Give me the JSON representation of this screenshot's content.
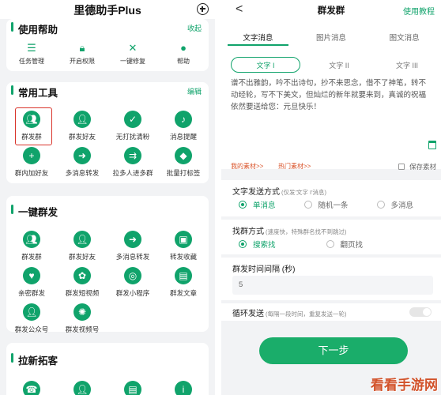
{
  "left": {
    "title": "里德助手Plus",
    "help_section": {
      "title": "使用帮助",
      "action": "收起",
      "items": [
        {
          "label": "任务管理",
          "icon": "task-list-icon"
        },
        {
          "label": "开启权限",
          "icon": "lock-icon"
        },
        {
          "label": "一键修复",
          "icon": "wrench-icon"
        },
        {
          "label": "帮助",
          "icon": "help-pin-icon"
        }
      ]
    },
    "tools_section": {
      "title": "常用工具",
      "action": "编辑",
      "items": [
        {
          "label": "群发群",
          "icon": "group-icon"
        },
        {
          "label": "群发好友",
          "icon": "friend-icon"
        },
        {
          "label": "无打扰清粉",
          "icon": "clean-icon"
        },
        {
          "label": "消息提醒",
          "icon": "bell-icon"
        },
        {
          "label": "群内加好友",
          "icon": "add-friend-icon"
        },
        {
          "label": "多消息转发",
          "icon": "forward-icon"
        },
        {
          "label": "拉多人进多群",
          "icon": "pull-group-icon"
        },
        {
          "label": "批量打标签",
          "icon": "tag-icon"
        }
      ]
    },
    "broadcast_section": {
      "title": "一键群发",
      "items": [
        {
          "label": "群发群",
          "icon": "group-icon"
        },
        {
          "label": "群发好友",
          "icon": "friend-icon"
        },
        {
          "label": "多消息转发",
          "icon": "forward-icon"
        },
        {
          "label": "转发收藏",
          "icon": "box-icon"
        },
        {
          "label": "亲密群发",
          "icon": "heart-chat-icon"
        },
        {
          "label": "群发短视频",
          "icon": "video-icon"
        },
        {
          "label": "群发小程序",
          "icon": "mini-program-icon"
        },
        {
          "label": "群发文章",
          "icon": "article-icon"
        },
        {
          "label": "群发公众号",
          "icon": "official-account-icon"
        },
        {
          "label": "群发视频号",
          "icon": "channel-icon"
        }
      ]
    },
    "invite_section": {
      "title": "拉新拓客"
    }
  },
  "right": {
    "back": "<",
    "title": "群发群",
    "help": "使用教程",
    "tabs": [
      "文字消息",
      "图片消息",
      "图文消息"
    ],
    "subtabs": [
      "文字 I",
      "文字 II",
      "文字 III"
    ],
    "message": "谱不出雅韵，吟不出诗句，抄不来思念，借不了神笔，转不动经轮，写不下美文，但灿烂的新年就要来到，真诚的祝福依然要送给您：元旦快乐！",
    "my_material": "我的素材>>",
    "hot_material": "热门素材>>",
    "save_material": "保存素材",
    "send_mode": {
      "label": "文字发送方式",
      "hint": "(仅发'文字 I'消息)",
      "options": [
        "单消息",
        "随机一条",
        "多消息"
      ],
      "selected": "单消息"
    },
    "find_mode": {
      "label": "找群方式",
      "hint": "(速度快，特殊群名找不到跳过)",
      "options": [
        "搜索找",
        "翻页找"
      ],
      "selected": "搜索找"
    },
    "interval": {
      "label": "群发时间间隔 (秒)",
      "value": "5"
    },
    "loop": {
      "label": "循环发送",
      "hint": "(每隔一段时间，重复发送一轮)",
      "enabled": false
    },
    "next_button": "下一步"
  },
  "watermark": "看看手游网",
  "colors": {
    "brand_green": "#10a36b",
    "link_orange": "#d9542b",
    "highlight_red": "#d9342b"
  }
}
